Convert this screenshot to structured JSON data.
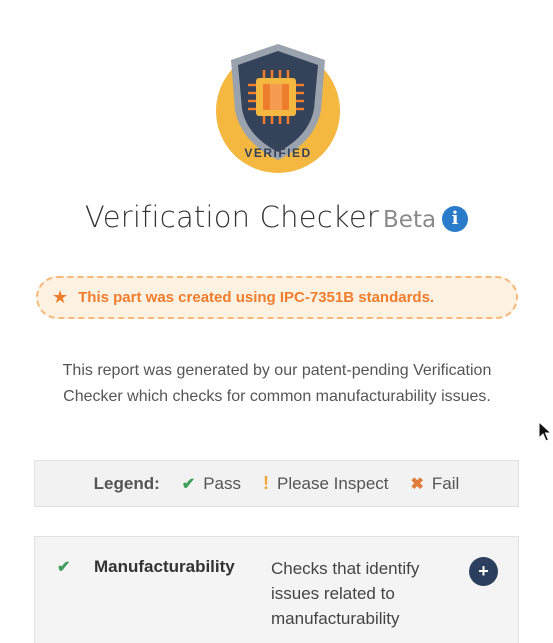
{
  "badge": {
    "text": "VERIFIED",
    "colors": {
      "circle": "#f4b73f",
      "shield": "#34425a",
      "shield_border": "#9aa3ad",
      "chip": "#ef7d2e"
    }
  },
  "header": {
    "title": "Verification Checker",
    "beta": "Beta",
    "info_icon": "i"
  },
  "notice": {
    "icon": "star-icon",
    "star": "★",
    "text": "This part was created using IPC-7351B standards.",
    "color": "#ef7d2e"
  },
  "description": {
    "text": "This report was generated by our patent-pending Verification Checker which checks for common manufacturability issues."
  },
  "legend": {
    "label": "Legend:",
    "items": [
      {
        "icon": "✔",
        "label": "Pass",
        "color": "#3f9e5a"
      },
      {
        "icon": "!",
        "label": "Please Inspect",
        "color": "#f3a43a"
      },
      {
        "icon": "✖",
        "label": "Fail",
        "color": "#e07b39"
      }
    ]
  },
  "checks": [
    {
      "status_icon": "✔",
      "name": "Manufacturability",
      "description": "Checks that identify issues related to manufacturability",
      "expand_icon": "+"
    }
  ]
}
